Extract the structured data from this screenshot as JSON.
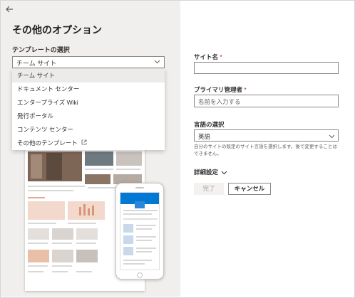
{
  "panel": {
    "title": "その他のオプション",
    "template_label": "テンプレートの選択",
    "template_selected": "チーム サイト",
    "template_options": [
      "チーム サイト",
      "ドキュメント センター",
      "エンタープライズ Wiki",
      "発行ポータル",
      "コンテンツ センター",
      "その他のテンプレート"
    ]
  },
  "form": {
    "site_name_label": "サイト名",
    "site_name_value": "",
    "required_mark": "*",
    "admin_label": "プライマリ管理者",
    "admin_placeholder": "名前を入力する",
    "language_label": "言語の選択",
    "language_value": "英語",
    "language_help": "自分のサイトの既定のサイト言語を選択します。後で変更することはできません。",
    "advanced_label": "詳細設定",
    "done_label": "完了",
    "cancel_label": "キャンセル"
  },
  "icons": {
    "back": "back-arrow-icon",
    "chevron": "chevron-down-icon",
    "external": "external-link-icon"
  },
  "colors": {
    "pane_bg": "#f1efed",
    "accent": "#0078d4",
    "required": "#a4262c"
  }
}
